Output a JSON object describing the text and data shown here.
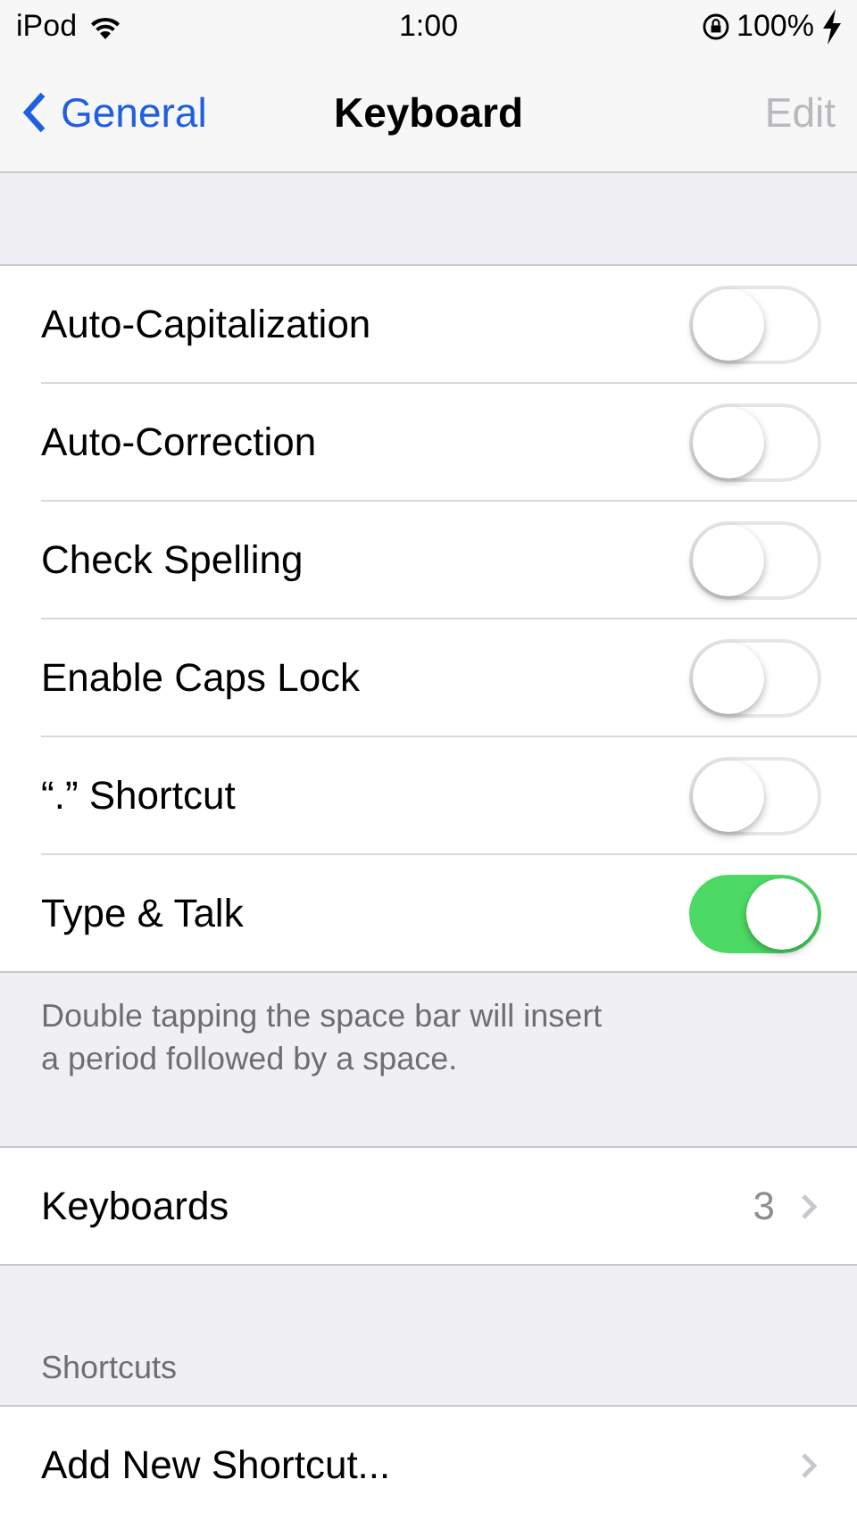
{
  "status_bar": {
    "carrier": "iPod",
    "time": "1:00",
    "battery": "100%"
  },
  "nav": {
    "back": "General",
    "title": "Keyboard",
    "action": "Edit",
    "action_disabled": true
  },
  "toggles": [
    {
      "label": "Auto-Capitalization",
      "on": false
    },
    {
      "label": "Auto-Correction",
      "on": false
    },
    {
      "label": "Check Spelling",
      "on": false
    },
    {
      "label": "Enable Caps Lock",
      "on": false
    },
    {
      "label": "“.” Shortcut",
      "on": false
    },
    {
      "label": "Type & Talk",
      "on": true
    }
  ],
  "toggles_footer": "Double tapping the space bar will insert a period followed by a space.",
  "keyboards": {
    "label": "Keyboards",
    "value": "3"
  },
  "shortcuts": {
    "header": "Shortcuts",
    "items": [
      {
        "label": "Add New Shortcut..."
      }
    ]
  }
}
